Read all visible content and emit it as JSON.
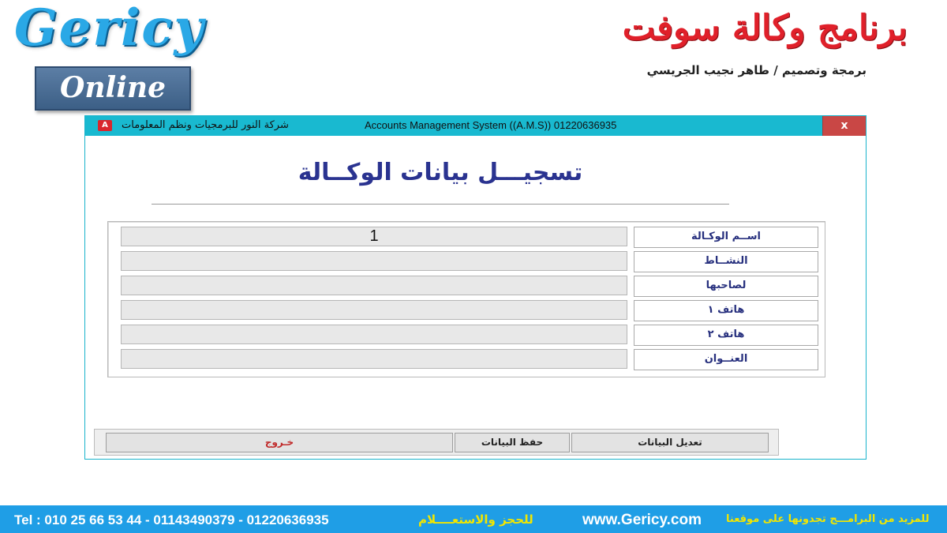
{
  "branding": {
    "logo_main": "Gericy",
    "logo_sub": "Online",
    "arabic_title": "برنامج وكالة سوفت",
    "credit": "برمجة وتصميم / طاهر نجيب الجريسي"
  },
  "window": {
    "title_arabic": "شركة النور للبرمجيات ونظم المعلومات",
    "title_english": "Accounts Management System ((A.M.S)) 01220636935",
    "close_label": "x",
    "icon_label": "A"
  },
  "form": {
    "title": "تسجيـــل بيانات الوكــالة",
    "fields": [
      {
        "label": "اســم الوكـالة",
        "value": "1"
      },
      {
        "label": "النشــاط",
        "value": ""
      },
      {
        "label": "لصاحبها",
        "value": ""
      },
      {
        "label": "هاتف ١",
        "value": ""
      },
      {
        "label": "هاتف ٢",
        "value": ""
      },
      {
        "label": "العنــوان",
        "value": ""
      }
    ]
  },
  "buttons": {
    "exit": "خـروج",
    "save": "حفظ البيانات",
    "edit": "تعديل البيانات"
  },
  "footer": {
    "tel": "Tel  :  010 25 66 53 44  - 01143490379  - 01220636935",
    "contact": "للحجز والاستعــــلام",
    "website": "www.Gericy.com",
    "more_programs": "للمزيد من البرامـــج تجدونها على موقعنا"
  },
  "colors": {
    "titlebar": "#19b9d0",
    "close_button": "#c94745",
    "form_title": "#2a3390",
    "footer": "#1f9ee6",
    "footer_accent": "#f2e600",
    "brand_red": "#e0202a",
    "brand_blue": "#2aa8e6"
  }
}
